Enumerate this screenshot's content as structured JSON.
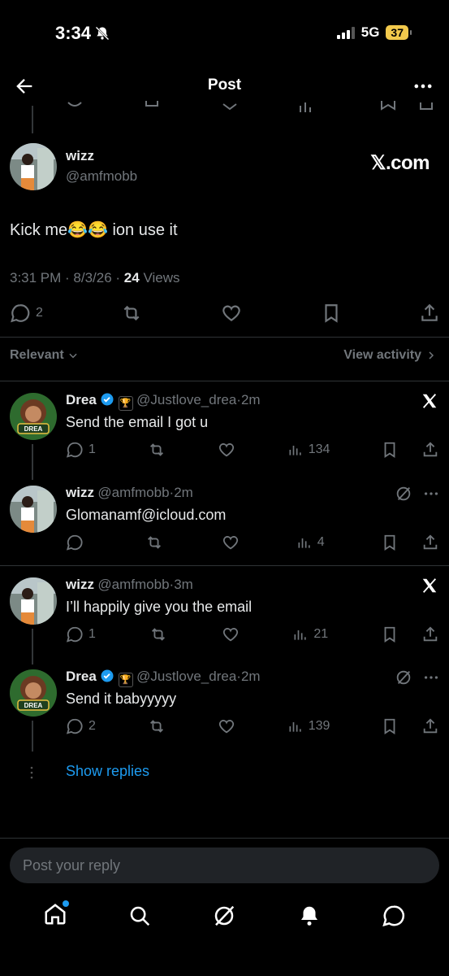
{
  "status_bar": {
    "time": "3:34",
    "network": "5G",
    "battery": "37"
  },
  "header": {
    "title": "Post"
  },
  "main_tweet": {
    "name": "wizz",
    "handle": "@amfmobb",
    "text": "Kick me😂😂 ion use it",
    "watermark": "𝕏.com",
    "time": "3:31 PM · 8/3/26 · ",
    "views_count": "24",
    "views_label": " Views",
    "replies": "2"
  },
  "sort": {
    "relevant": "Relevant",
    "view_activity": "View activity"
  },
  "replies": [
    {
      "name": "Drea",
      "handle": "@Justlove_drea",
      "dot": "·",
      "time": "2m",
      "text": "Send the email I got u",
      "reply_count": "1",
      "views": "134",
      "verified": true
    },
    {
      "name": "wizz",
      "handle": "@amfmobb",
      "dot": "·",
      "time": "2m",
      "text": "Glomanamf@icloud.com",
      "reply_count": "",
      "views": "4",
      "verified": false
    },
    {
      "name": "wizz",
      "handle": "@amfmobb",
      "dot": "·",
      "time": "3m",
      "text": "I’ll happily give you the email",
      "reply_count": "1",
      "views": "21",
      "verified": false
    },
    {
      "name": "Drea",
      "handle": "@Justlove_drea",
      "dot": "·",
      "time": "2m",
      "text": "Send it babyyyyy",
      "reply_count": "2",
      "views": "139",
      "verified": true
    }
  ],
  "show_replies": "Show replies",
  "compose": {
    "placeholder": "Post your reply"
  },
  "colors": {
    "background": "#000000",
    "accent": "#1d9bf0",
    "muted": "#71767b",
    "battery": "#f2c94c"
  }
}
